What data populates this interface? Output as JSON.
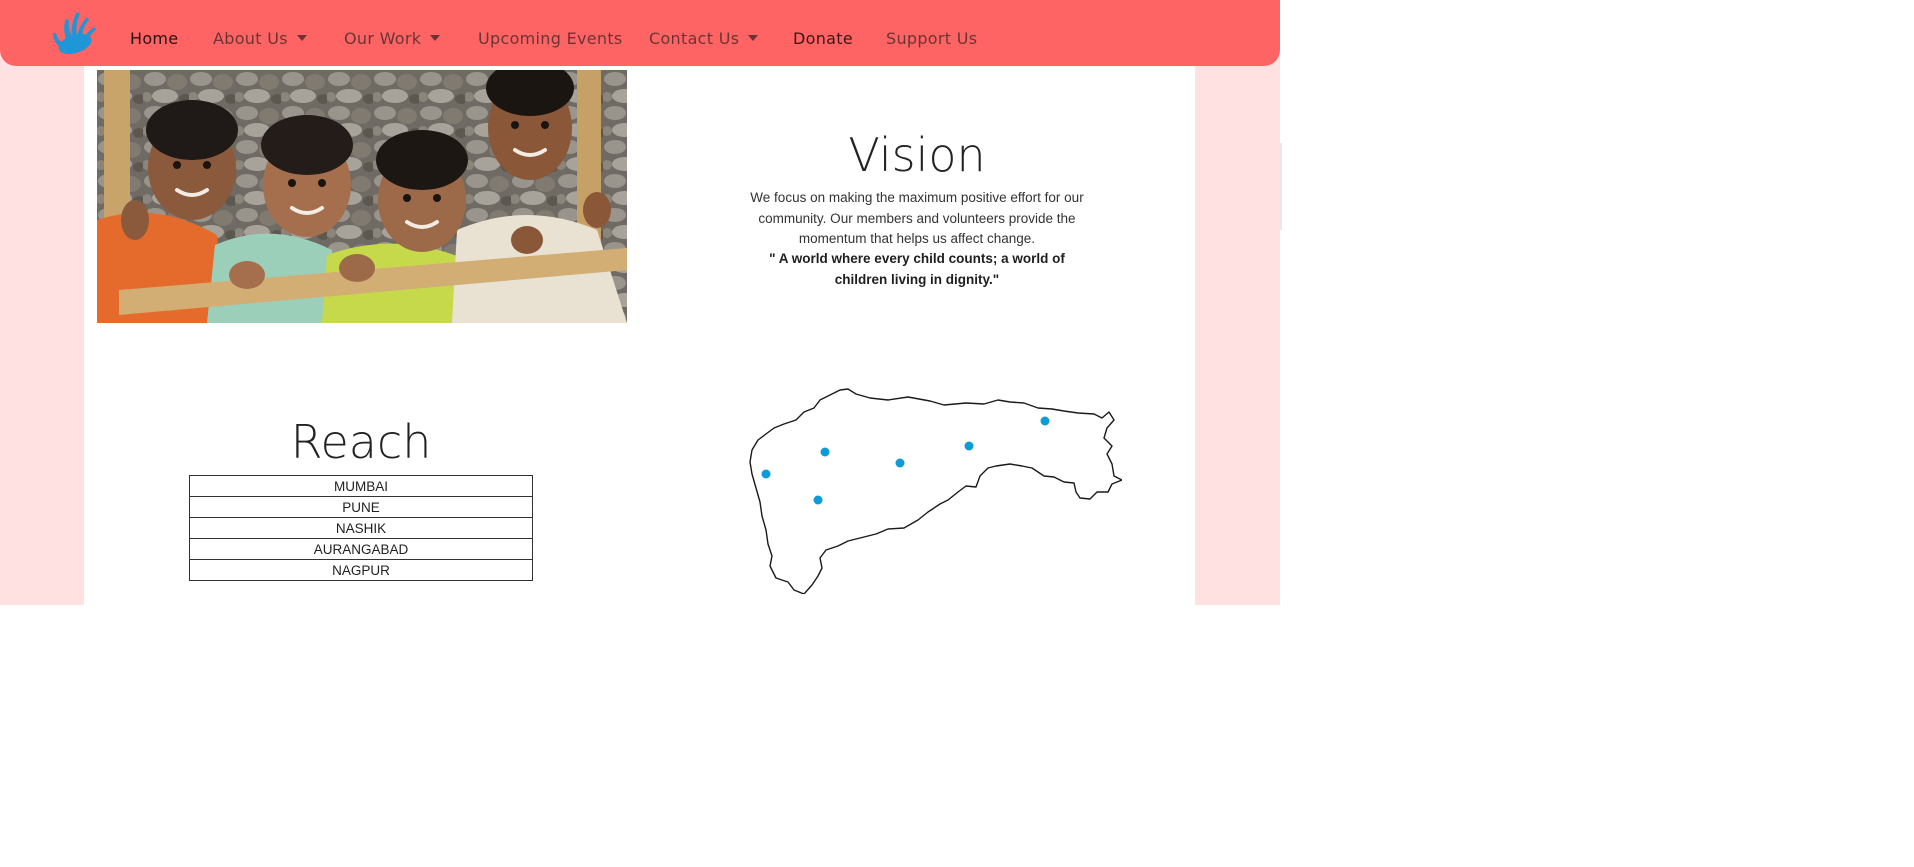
{
  "nav": {
    "items": [
      {
        "label": "Home"
      },
      {
        "label": "About Us"
      },
      {
        "label": "Our Work"
      },
      {
        "label": "Upcoming Events"
      },
      {
        "label": "Contact Us"
      },
      {
        "label": "Donate"
      },
      {
        "label": "Support Us"
      }
    ]
  },
  "vision": {
    "title": "Vision",
    "text": "We focus on making the maximum positive effort for our community. Our members and volunteers provide the momentum that helps us affect change.",
    "quote": "\" A world where every child counts; a world of children living in dignity.\""
  },
  "reach": {
    "title": "Reach",
    "cities": [
      "MUMBAI",
      "PUNE",
      "NASHIK",
      "AURANGABAD",
      "NAGPUR"
    ]
  },
  "icons": {
    "logo": "hand-logo-icon",
    "dropdown": "caret-down-icon"
  },
  "colors": {
    "navbar": "#ff6464",
    "page_background": "#ffe1e1",
    "logo": "#1e96d7",
    "map_marker": "#0f9bd7"
  }
}
